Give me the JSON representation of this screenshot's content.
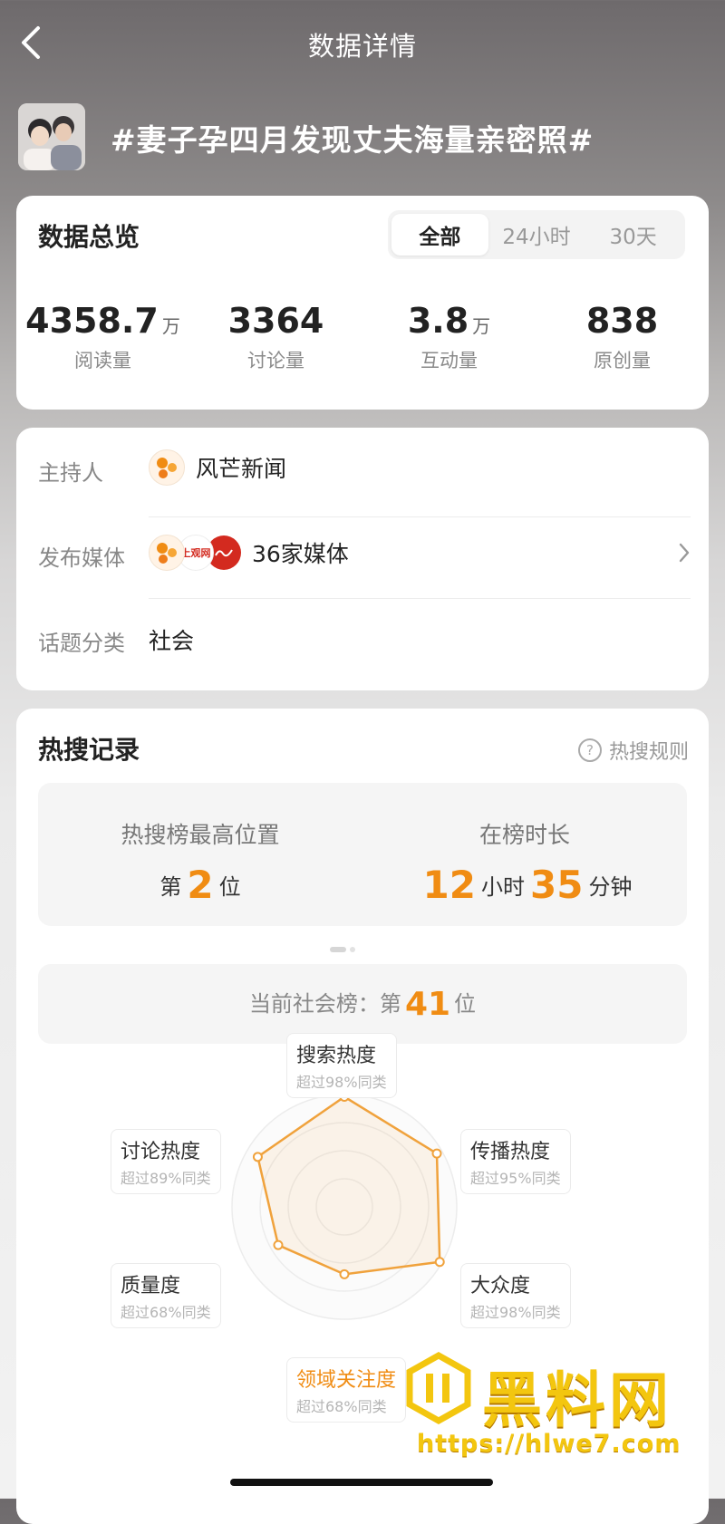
{
  "header": {
    "title": "数据详情",
    "back_icon": "chevron-left-icon"
  },
  "topic": {
    "title": "#妻子孕四月发现丈夫海量亲密照#"
  },
  "overview": {
    "title": "数据总览",
    "tabs": [
      "全部",
      "24小时",
      "30天"
    ],
    "active_tab": "全部",
    "stats": [
      {
        "value": "4358.7",
        "unit": "万",
        "label": "阅读量"
      },
      {
        "value": "3364",
        "unit": "",
        "label": "讨论量"
      },
      {
        "value": "3.8",
        "unit": "万",
        "label": "互动量"
      },
      {
        "value": "838",
        "unit": "",
        "label": "原创量"
      }
    ]
  },
  "info": {
    "host_label": "主持人",
    "host_name": "风芒新闻",
    "media_label": "发布媒体",
    "media_value": "36家媒体",
    "category_label": "话题分类",
    "category_value": "社会",
    "media_logo_text": "上观网"
  },
  "hot_search": {
    "title": "热搜记录",
    "rules_label": "热搜规则",
    "highest_caption": "热搜榜最高位置",
    "highest_prefix": "第",
    "highest_rank": "2",
    "highest_suffix": "位",
    "duration_caption": "在榜时长",
    "duration_hours": "12",
    "hours_unit": "小时",
    "duration_minutes": "35",
    "minutes_unit": "分钟",
    "current_prefix": "当前社会榜：第",
    "current_rank": "41",
    "current_suffix": "位"
  },
  "radar": {
    "accent_color": "#f08c13",
    "axes": [
      {
        "name": "搜索热度",
        "sub": "超过98%同类",
        "percent": 98
      },
      {
        "name": "传播热度",
        "sub": "超过95%同类",
        "percent": 95
      },
      {
        "name": "大众度",
        "sub": "超过98%同类",
        "percent": 98
      },
      {
        "name": "领域关注度",
        "sub": "超过68%同类",
        "percent": 60
      },
      {
        "name": "质量度",
        "sub": "超过68%同类",
        "percent": 68
      },
      {
        "name": "讨论热度",
        "sub": "超过89%同类",
        "percent": 89
      }
    ]
  },
  "watermark": {
    "brand": "黑料网",
    "url": "https://hlwe7.com"
  }
}
